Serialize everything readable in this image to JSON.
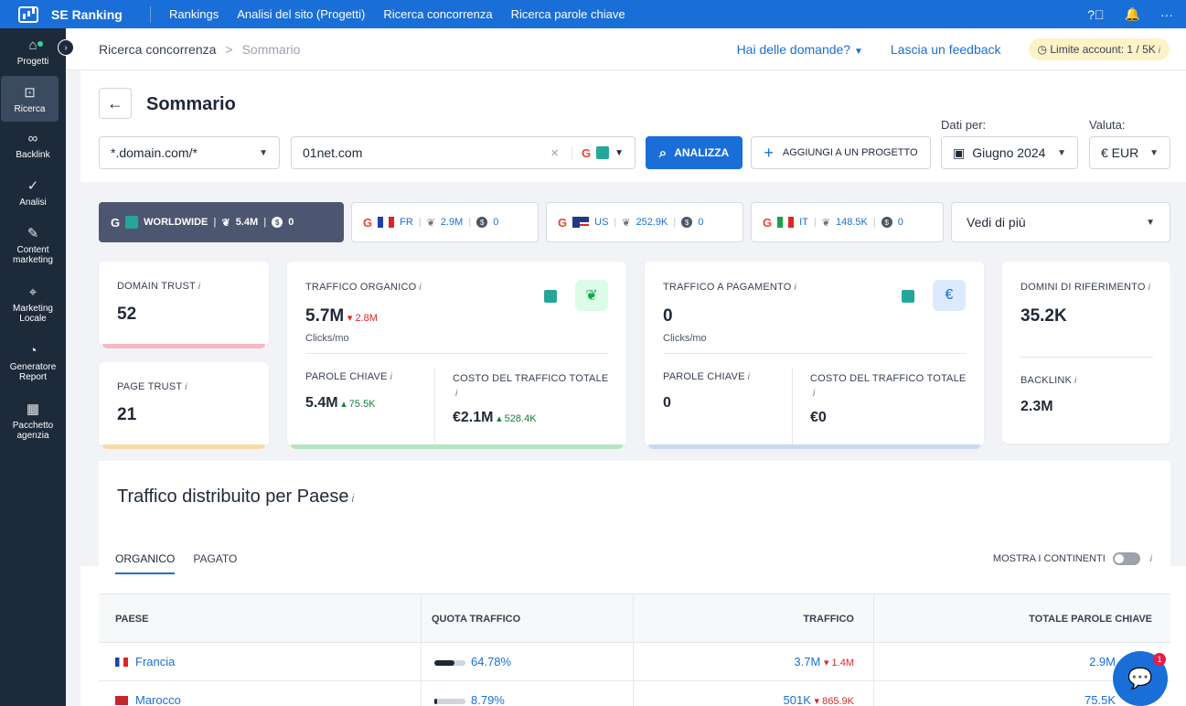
{
  "topbar": {
    "brand": "SE Ranking",
    "nav": [
      "Rankings",
      "Analisi del sito (Progetti)",
      "Ricerca concorrenza",
      "Ricerca parole chiave"
    ]
  },
  "sidebar": {
    "items": [
      {
        "label": "Progetti",
        "icon": "home-icon"
      },
      {
        "label": "Ricerca",
        "icon": "search-icon"
      },
      {
        "label": "Backlink",
        "icon": "link-icon"
      },
      {
        "label": "Analisi",
        "icon": "check-circle-icon"
      },
      {
        "label": "Content marketing",
        "icon": "edit-icon"
      },
      {
        "label": "Marketing Locale",
        "icon": "map-pin-icon"
      },
      {
        "label": "Generatore Report",
        "icon": "pie-chart-icon"
      },
      {
        "label": "Pacchetto agenzia",
        "icon": "building-icon"
      }
    ]
  },
  "breadcrumb": {
    "parent": "Ricerca concorrenza",
    "sep": ">",
    "current": "Sommario"
  },
  "header_links": {
    "questions": "Hai delle domande?",
    "feedback": "Lascia un feedback",
    "limit": "Limite account: 1 / 5K",
    "info": "i"
  },
  "page": {
    "title": "Sommario"
  },
  "search": {
    "mode": "*.domain.com/*",
    "domain": "01net.com",
    "analyze": "ANALIZZA",
    "add_project": "AGGIUNGI A UN PROGETTO",
    "date_label": "Dati per:",
    "date_value": "Giugno 2024",
    "currency_label": "Valuta:",
    "currency_value": "€ EUR"
  },
  "regions": {
    "worldwide": {
      "name": "WORLDWIDE",
      "traffic": "5.4M",
      "paid": "0"
    },
    "fr": {
      "code": "FR",
      "traffic": "2.9M",
      "paid": "0"
    },
    "us": {
      "code": "US",
      "traffic": "252.9K",
      "paid": "0"
    },
    "it": {
      "code": "IT",
      "traffic": "148.5K",
      "paid": "0"
    },
    "more": "Vedi di più"
  },
  "metrics": {
    "domain_trust": {
      "label": "DOMAIN TRUST",
      "value": "52"
    },
    "page_trust": {
      "label": "PAGE TRUST",
      "value": "21"
    },
    "organic": {
      "label": "TRAFFICO ORGANICO",
      "value": "5.7M",
      "delta": "2.8M",
      "unit": "Clicks/mo",
      "kw_label": "PAROLE CHIAVE",
      "kw_value": "5.4M",
      "kw_delta": "75.5K",
      "cost_label": "COSTO DEL TRAFFICO TOTALE",
      "cost_value": "€2.1M",
      "cost_delta": "528.4K"
    },
    "paid": {
      "label": "TRAFFICO A PAGAMENTO",
      "value": "0",
      "unit": "Clicks/mo",
      "kw_label": "PAROLE CHIAVE",
      "kw_value": "0",
      "cost_label": "COSTO DEL TRAFFICO TOTALE",
      "cost_value": "€0"
    },
    "referring": {
      "label": "DOMINI DI RIFERIMENTO",
      "value": "35.2K",
      "bl_label": "BACKLINK",
      "bl_value": "2.3M"
    }
  },
  "country_section": {
    "title": "Traffico distribuito per Paese",
    "tabs": [
      "ORGANICO",
      "PAGATO"
    ],
    "toggle_label": "MOSTRA I CONTINENTI",
    "columns": [
      "PAESE",
      "QUOTA TRAFFICO",
      "TRAFFICO",
      "TOTALE PAROLE CHIAVE"
    ],
    "rows": [
      {
        "country": "Francia",
        "share": "64.78%",
        "share_fraction": 0.6478,
        "traffic": "3.7M",
        "delta": "1.4M",
        "keywords": "2.9M"
      },
      {
        "country": "Marocco",
        "share": "8.79%",
        "share_fraction": 0.0879,
        "traffic": "501K",
        "delta": "865.9K",
        "keywords": "75.5K"
      }
    ]
  },
  "chat": {
    "badge": "1"
  }
}
